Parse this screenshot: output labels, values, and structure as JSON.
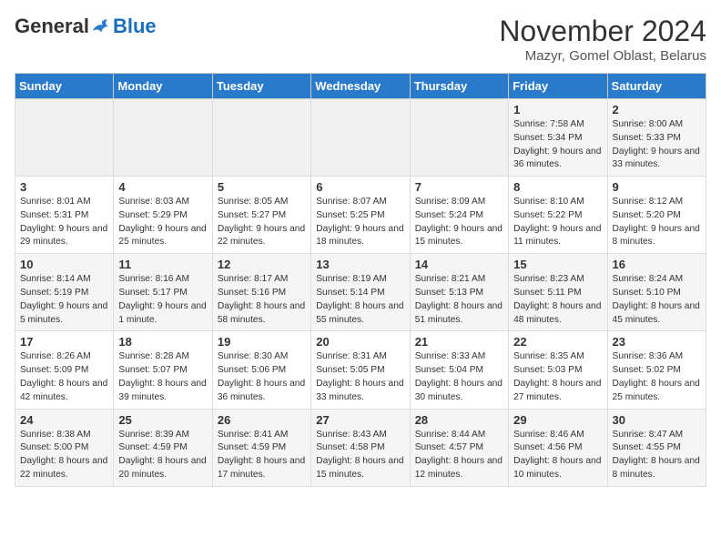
{
  "header": {
    "logo_general": "General",
    "logo_blue": "Blue",
    "month_title": "November 2024",
    "location": "Mazyr, Gomel Oblast, Belarus"
  },
  "days_of_week": [
    "Sunday",
    "Monday",
    "Tuesday",
    "Wednesday",
    "Thursday",
    "Friday",
    "Saturday"
  ],
  "weeks": [
    [
      {
        "day": "",
        "info": ""
      },
      {
        "day": "",
        "info": ""
      },
      {
        "day": "",
        "info": ""
      },
      {
        "day": "",
        "info": ""
      },
      {
        "day": "",
        "info": ""
      },
      {
        "day": "1",
        "info": "Sunrise: 7:58 AM\nSunset: 5:34 PM\nDaylight: 9 hours and 36 minutes."
      },
      {
        "day": "2",
        "info": "Sunrise: 8:00 AM\nSunset: 5:33 PM\nDaylight: 9 hours and 33 minutes."
      }
    ],
    [
      {
        "day": "3",
        "info": "Sunrise: 8:01 AM\nSunset: 5:31 PM\nDaylight: 9 hours and 29 minutes."
      },
      {
        "day": "4",
        "info": "Sunrise: 8:03 AM\nSunset: 5:29 PM\nDaylight: 9 hours and 25 minutes."
      },
      {
        "day": "5",
        "info": "Sunrise: 8:05 AM\nSunset: 5:27 PM\nDaylight: 9 hours and 22 minutes."
      },
      {
        "day": "6",
        "info": "Sunrise: 8:07 AM\nSunset: 5:25 PM\nDaylight: 9 hours and 18 minutes."
      },
      {
        "day": "7",
        "info": "Sunrise: 8:09 AM\nSunset: 5:24 PM\nDaylight: 9 hours and 15 minutes."
      },
      {
        "day": "8",
        "info": "Sunrise: 8:10 AM\nSunset: 5:22 PM\nDaylight: 9 hours and 11 minutes."
      },
      {
        "day": "9",
        "info": "Sunrise: 8:12 AM\nSunset: 5:20 PM\nDaylight: 9 hours and 8 minutes."
      }
    ],
    [
      {
        "day": "10",
        "info": "Sunrise: 8:14 AM\nSunset: 5:19 PM\nDaylight: 9 hours and 5 minutes."
      },
      {
        "day": "11",
        "info": "Sunrise: 8:16 AM\nSunset: 5:17 PM\nDaylight: 9 hours and 1 minute."
      },
      {
        "day": "12",
        "info": "Sunrise: 8:17 AM\nSunset: 5:16 PM\nDaylight: 8 hours and 58 minutes."
      },
      {
        "day": "13",
        "info": "Sunrise: 8:19 AM\nSunset: 5:14 PM\nDaylight: 8 hours and 55 minutes."
      },
      {
        "day": "14",
        "info": "Sunrise: 8:21 AM\nSunset: 5:13 PM\nDaylight: 8 hours and 51 minutes."
      },
      {
        "day": "15",
        "info": "Sunrise: 8:23 AM\nSunset: 5:11 PM\nDaylight: 8 hours and 48 minutes."
      },
      {
        "day": "16",
        "info": "Sunrise: 8:24 AM\nSunset: 5:10 PM\nDaylight: 8 hours and 45 minutes."
      }
    ],
    [
      {
        "day": "17",
        "info": "Sunrise: 8:26 AM\nSunset: 5:09 PM\nDaylight: 8 hours and 42 minutes."
      },
      {
        "day": "18",
        "info": "Sunrise: 8:28 AM\nSunset: 5:07 PM\nDaylight: 8 hours and 39 minutes."
      },
      {
        "day": "19",
        "info": "Sunrise: 8:30 AM\nSunset: 5:06 PM\nDaylight: 8 hours and 36 minutes."
      },
      {
        "day": "20",
        "info": "Sunrise: 8:31 AM\nSunset: 5:05 PM\nDaylight: 8 hours and 33 minutes."
      },
      {
        "day": "21",
        "info": "Sunrise: 8:33 AM\nSunset: 5:04 PM\nDaylight: 8 hours and 30 minutes."
      },
      {
        "day": "22",
        "info": "Sunrise: 8:35 AM\nSunset: 5:03 PM\nDaylight: 8 hours and 27 minutes."
      },
      {
        "day": "23",
        "info": "Sunrise: 8:36 AM\nSunset: 5:02 PM\nDaylight: 8 hours and 25 minutes."
      }
    ],
    [
      {
        "day": "24",
        "info": "Sunrise: 8:38 AM\nSunset: 5:00 PM\nDaylight: 8 hours and 22 minutes."
      },
      {
        "day": "25",
        "info": "Sunrise: 8:39 AM\nSunset: 4:59 PM\nDaylight: 8 hours and 20 minutes."
      },
      {
        "day": "26",
        "info": "Sunrise: 8:41 AM\nSunset: 4:59 PM\nDaylight: 8 hours and 17 minutes."
      },
      {
        "day": "27",
        "info": "Sunrise: 8:43 AM\nSunset: 4:58 PM\nDaylight: 8 hours and 15 minutes."
      },
      {
        "day": "28",
        "info": "Sunrise: 8:44 AM\nSunset: 4:57 PM\nDaylight: 8 hours and 12 minutes."
      },
      {
        "day": "29",
        "info": "Sunrise: 8:46 AM\nSunset: 4:56 PM\nDaylight: 8 hours and 10 minutes."
      },
      {
        "day": "30",
        "info": "Sunrise: 8:47 AM\nSunset: 4:55 PM\nDaylight: 8 hours and 8 minutes."
      }
    ]
  ]
}
